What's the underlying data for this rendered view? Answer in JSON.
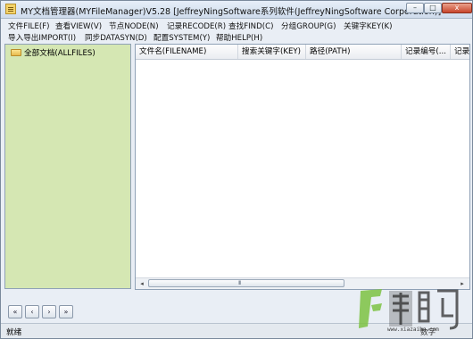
{
  "window": {
    "title": "MY文档管理器(MYFileManager)V5.28 [JeffreyNingSoftware系列软件(JeffreyNingSoftware Corporation)]",
    "controls": [
      "–",
      "□",
      "x"
    ]
  },
  "menu": {
    "row1": [
      "文件FILE(F)",
      "查看VIEW(V)",
      "节点NODE(N)",
      "记录RECODE(R)",
      "查找FIND(C)",
      "分组GROUP(G)",
      "关键字KEY(K)"
    ],
    "row2": [
      "导入导出IMPORT(I)",
      "同步DATASYN(D)",
      "配置SYSTEM(Y)",
      "帮助HELP(H)"
    ]
  },
  "tree": {
    "root_label": "全部文档(ALLFILES)",
    "root_icon": "folder-icon"
  },
  "list": {
    "columns": [
      "文件名(FILENAME)",
      "搜索关键字(KEY)",
      "路径(PATH)",
      "记录编号(...",
      "记录"
    ],
    "rows": [],
    "scroll_left": "◂",
    "scroll_right": "▸",
    "scroll_grip": "III"
  },
  "pager": {
    "first": "«",
    "prev": "‹",
    "next": "›",
    "last": "»"
  },
  "status": {
    "left": "就绪",
    "right": "数字"
  },
  "watermark": {
    "text": "下载吧",
    "url": "www.xiazaiba.com"
  },
  "colors": {
    "tree_bg": "#d5e7b3",
    "window_bg": "#e9eef5",
    "close_button": "#c8452b"
  }
}
